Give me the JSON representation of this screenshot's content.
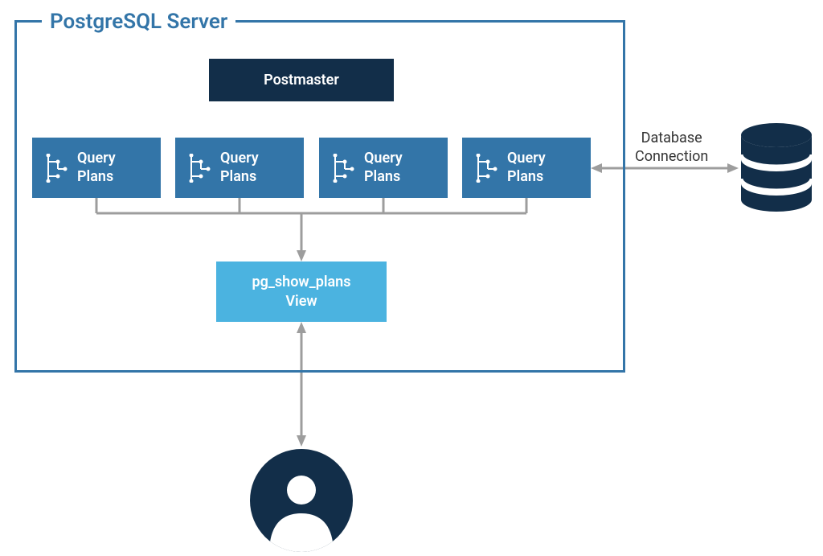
{
  "server": {
    "title": "PostgreSQL Server",
    "postmaster_label": "Postmaster",
    "query_plans": [
      {
        "label": "Query\nPlans"
      },
      {
        "label": "Query\nPlans"
      },
      {
        "label": "Query\nPlans"
      },
      {
        "label": "Query\nPlans"
      }
    ],
    "view": {
      "line1": "pg_show_plans",
      "line2": "View"
    }
  },
  "db": {
    "label_line1": "Database",
    "label_line2": "Connection"
  }
}
